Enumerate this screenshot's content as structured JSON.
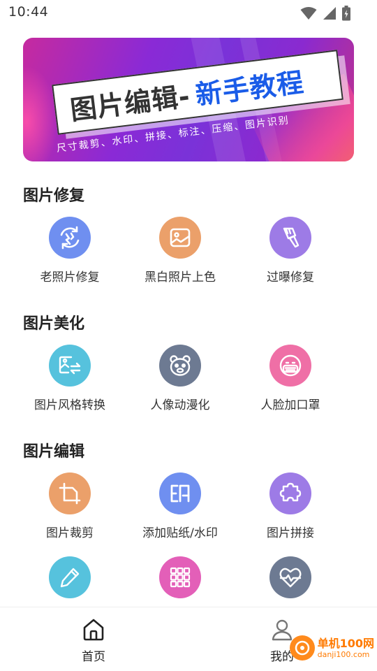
{
  "status_bar": {
    "time": "10:44"
  },
  "banner": {
    "title_main": "图片编辑-",
    "title_accent": "新手教程",
    "subtitle": "尺寸裁剪、水印、拼接、标注、压缩、图片识别"
  },
  "sections": [
    {
      "title": "图片修复",
      "items": [
        {
          "label": "老照片修复",
          "icon": "photo-restore-icon",
          "color": "#6f8ff0"
        },
        {
          "label": "黑白照片上色",
          "icon": "image-colorize-icon",
          "color": "#eba06a"
        },
        {
          "label": "过曝修复",
          "icon": "brush-icon",
          "color": "#9d7be6"
        }
      ]
    },
    {
      "title": "图片美化",
      "items": [
        {
          "label": "图片风格转换",
          "icon": "style-transfer-icon",
          "color": "#56c2dd"
        },
        {
          "label": "人像动漫化",
          "icon": "anime-face-icon",
          "color": "#6d7a92"
        },
        {
          "label": "人脸加口罩",
          "icon": "face-mask-icon",
          "color": "#ef6fa6"
        }
      ]
    },
    {
      "title": "图片编辑",
      "items": [
        {
          "label": "图片裁剪",
          "icon": "crop-icon",
          "color": "#eba06a"
        },
        {
          "label": "添加贴纸/水印",
          "icon": "stamp-icon",
          "color": "#6f8ff0"
        },
        {
          "label": "图片拼接",
          "icon": "puzzle-icon",
          "color": "#9d7be6"
        }
      ],
      "more_items": [
        {
          "icon": "pencil-icon",
          "color": "#56c2dd"
        },
        {
          "icon": "grid-icon",
          "color": "#e35fb8"
        },
        {
          "icon": "heart-pulse-icon",
          "color": "#6d7a92"
        }
      ]
    }
  ],
  "bottom_nav": {
    "home_label": "首页",
    "me_label": "我的"
  },
  "watermark": {
    "name": "单机100网",
    "url": "danji100.com"
  }
}
